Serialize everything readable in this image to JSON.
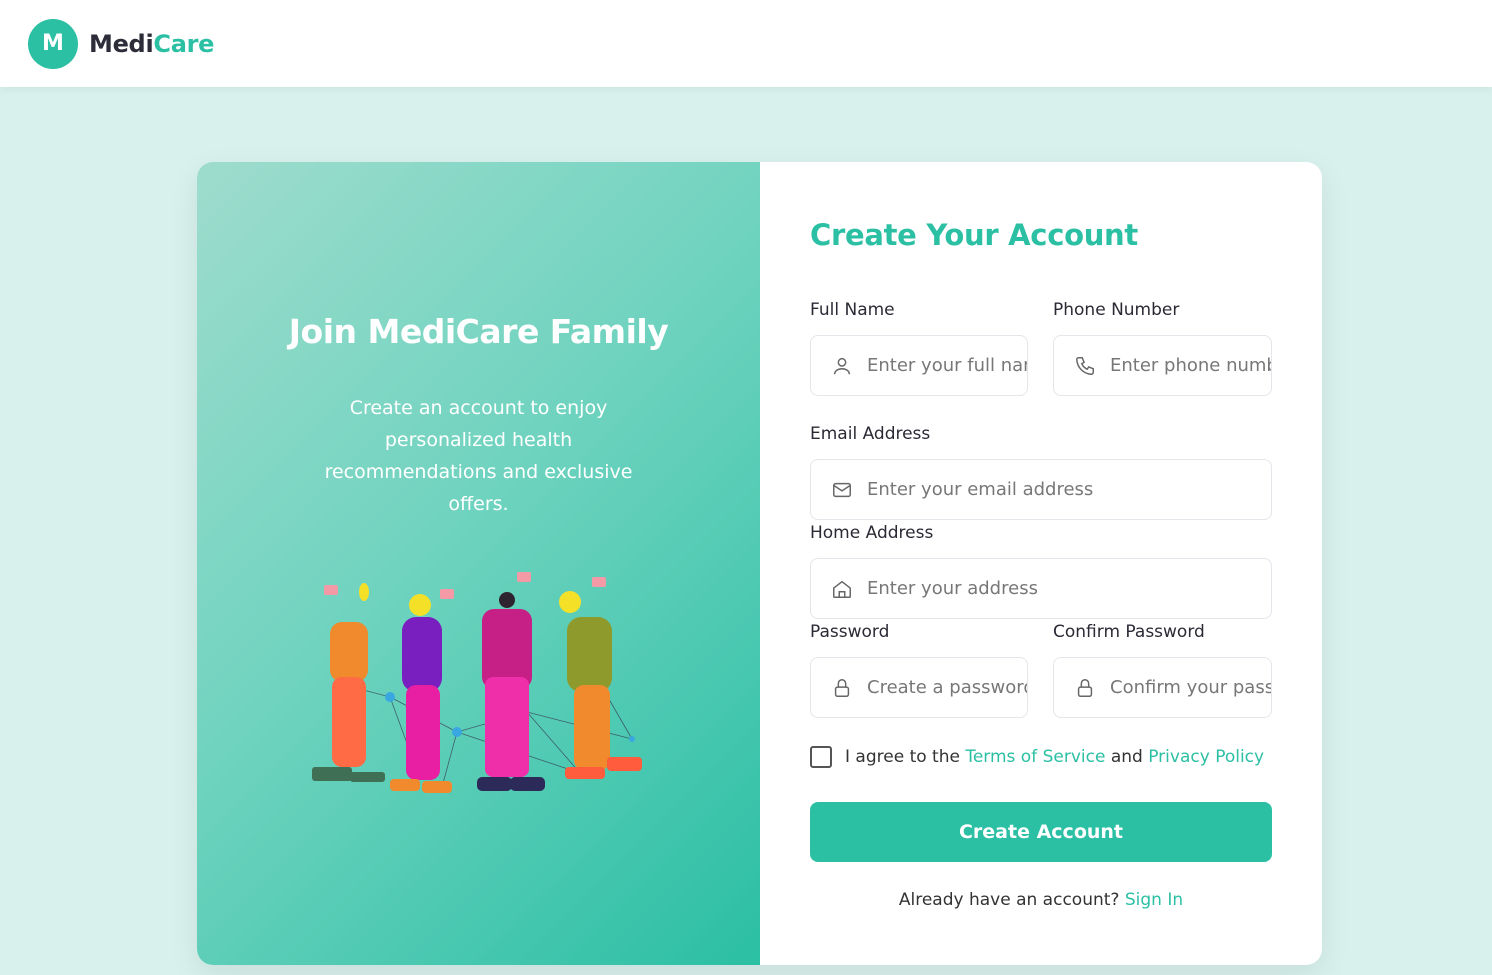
{
  "brand": {
    "logo_letter": "M",
    "name_part1": "Medi",
    "name_part2": "Care",
    "accent_color": "#2bbfa4"
  },
  "left": {
    "title": "Join MediCare Family",
    "subtitle": "Create an account to enjoy personalized health recommendations and exclusive offers."
  },
  "form": {
    "title": "Create Your Account",
    "full_name": {
      "label": "Full Name",
      "placeholder": "Enter your full name",
      "icon": "user-icon"
    },
    "phone": {
      "label": "Phone Number",
      "placeholder": "Enter phone number",
      "icon": "phone-icon"
    },
    "email": {
      "label": "Email Address",
      "placeholder": "Enter your email address",
      "icon": "mail-icon"
    },
    "address": {
      "label": "Home Address",
      "placeholder": "Enter your address",
      "icon": "home-icon"
    },
    "password": {
      "label": "Password",
      "placeholder": "Create a password",
      "icon": "lock-icon"
    },
    "confirm_password": {
      "label": "Confirm Password",
      "placeholder": "Confirm your password",
      "icon": "lock-icon"
    },
    "agree": {
      "prefix": "I agree to the",
      "terms": "Terms of Service",
      "and": "and",
      "privacy": "Privacy Policy"
    },
    "submit_label": "Create Account",
    "signin_prompt": "Already have an account?",
    "signin_link": "Sign In"
  }
}
